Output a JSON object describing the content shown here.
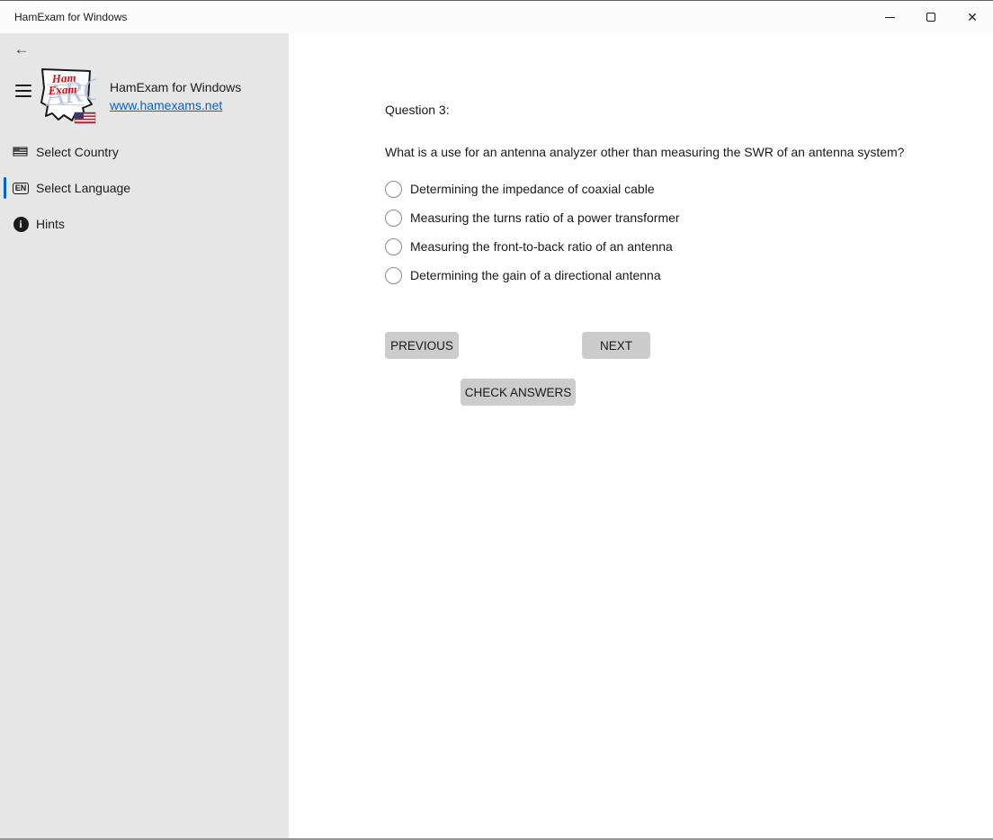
{
  "window": {
    "title": "HamExam for Windows"
  },
  "sidebar": {
    "app_title": "HamExam for Windows",
    "link_text": "www.hamexams.net",
    "logo": {
      "line1": "Ham",
      "line2": "Exam",
      "watermark": "ARC"
    },
    "items": [
      {
        "label": "Select Country",
        "icon": "country-flag-icon",
        "selected": false
      },
      {
        "label": "Select Language",
        "icon": "language-en-icon",
        "badge": "EN",
        "selected": true
      },
      {
        "label": "Hints",
        "icon": "info-icon",
        "badge": "i",
        "selected": false
      }
    ]
  },
  "main": {
    "question_label": "Question 3:",
    "question_text": "What is a use for an antenna analyzer other than measuring the SWR of an antenna system?",
    "options": [
      {
        "label": "Determining the impedance of coaxial cable",
        "selected": false
      },
      {
        "label": "Measuring the turns ratio of a power transformer",
        "selected": false
      },
      {
        "label": "Measuring the front-to-back ratio of an antenna",
        "selected": false
      },
      {
        "label": "Determining the gain of a directional antenna",
        "selected": false
      }
    ],
    "buttons": {
      "previous": "PREVIOUS",
      "next": "NEXT",
      "check_answers": "CHECK ANSWERS"
    }
  },
  "colors": {
    "accent": "#0067c0",
    "link": "#0066cc",
    "sidebar_bg": "#e6e6e6",
    "titlebar_bg": "#fbfbfb",
    "button_bg": "#cccccc"
  }
}
